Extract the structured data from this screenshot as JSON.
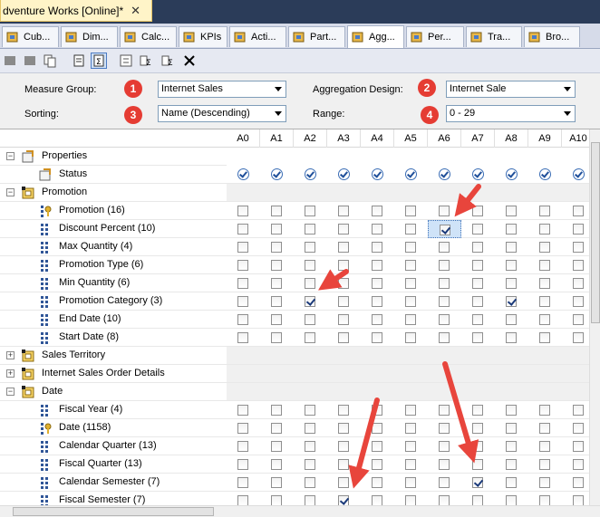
{
  "doc_tab": {
    "title": "dventure Works [Online]*",
    "close": "✕"
  },
  "designer_tabs": [
    {
      "label": "Cub...",
      "icon": "cube-icon"
    },
    {
      "label": "Dim...",
      "icon": "dimension-icon"
    },
    {
      "label": "Calc...",
      "icon": "calculations-icon"
    },
    {
      "label": "KPIs",
      "icon": "kpi-icon"
    },
    {
      "label": "Acti...",
      "icon": "actions-icon"
    },
    {
      "label": "Part...",
      "icon": "partitions-icon"
    },
    {
      "label": "Agg...",
      "icon": "aggregations-icon"
    },
    {
      "label": "Per...",
      "icon": "perspectives-icon"
    },
    {
      "label": "Tra...",
      "icon": "translations-icon"
    },
    {
      "label": "Bro...",
      "icon": "browser-icon"
    }
  ],
  "filters": {
    "measure_group_label": "Measure Group:",
    "measure_group_value": "Internet Sales",
    "sorting_label": "Sorting:",
    "sorting_value": "Name (Descending)",
    "aggregation_design_label": "Aggregation Design:",
    "aggregation_design_value": "Internet Sale",
    "range_label": "Range:",
    "range_value": "0 - 29"
  },
  "badges": [
    "1",
    "2",
    "3",
    "4"
  ],
  "columns": [
    "A0",
    "A1",
    "A2",
    "A3",
    "A4",
    "A5",
    "A6",
    "A7",
    "A8",
    "A9",
    "A10"
  ],
  "rows": [
    {
      "label": "Properties",
      "level": 0,
      "expander": "−",
      "kind": "header",
      "icon": "properties-icon"
    },
    {
      "label": "Status",
      "level": 1,
      "kind": "status",
      "icon": "status-icon"
    },
    {
      "label": "Promotion",
      "level": 0,
      "expander": "−",
      "kind": "header",
      "icon": "dimension-icon"
    },
    {
      "label": "Promotion (16)",
      "level": 1,
      "kind": "attr",
      "icon": "key-attribute-icon",
      "checked": []
    },
    {
      "label": "Discount Percent (10)",
      "level": 1,
      "kind": "attr",
      "icon": "attribute-icon",
      "checked": [
        6
      ],
      "selected": 6
    },
    {
      "label": "Max Quantity (4)",
      "level": 1,
      "kind": "attr",
      "icon": "attribute-icon",
      "checked": []
    },
    {
      "label": "Promotion Type (6)",
      "level": 1,
      "kind": "attr",
      "icon": "attribute-icon",
      "checked": []
    },
    {
      "label": "Min Quantity (6)",
      "level": 1,
      "kind": "attr",
      "icon": "attribute-icon",
      "checked": []
    },
    {
      "label": "Promotion Category (3)",
      "level": 1,
      "kind": "attr",
      "icon": "attribute-icon",
      "checked": [
        2,
        8
      ]
    },
    {
      "label": "End Date (10)",
      "level": 1,
      "kind": "attr",
      "icon": "attribute-icon",
      "checked": []
    },
    {
      "label": "Start Date (8)",
      "level": 1,
      "kind": "attr",
      "icon": "attribute-icon",
      "checked": []
    },
    {
      "label": "Sales Territory",
      "level": 0,
      "expander": "+",
      "kind": "header",
      "icon": "dimension-icon"
    },
    {
      "label": "Internet Sales Order Details",
      "level": 0,
      "expander": "+",
      "kind": "header",
      "icon": "dimension-icon"
    },
    {
      "label": "Date",
      "level": 0,
      "expander": "−",
      "kind": "header",
      "icon": "dimension-icon"
    },
    {
      "label": "Fiscal Year (4)",
      "level": 1,
      "kind": "attr",
      "icon": "attribute-icon",
      "checked": []
    },
    {
      "label": "Date (1158)",
      "level": 1,
      "kind": "attr",
      "icon": "key-attribute-icon",
      "checked": []
    },
    {
      "label": "Calendar Quarter (13)",
      "level": 1,
      "kind": "attr",
      "icon": "attribute-icon",
      "checked": []
    },
    {
      "label": "Fiscal Quarter (13)",
      "level": 1,
      "kind": "attr",
      "icon": "attribute-icon",
      "checked": []
    },
    {
      "label": "Calendar Semester (7)",
      "level": 1,
      "kind": "attr",
      "icon": "attribute-icon",
      "checked": [
        7
      ]
    },
    {
      "label": "Fiscal Semester (7)",
      "level": 1,
      "kind": "attr",
      "icon": "attribute-icon",
      "checked": [
        3
      ]
    }
  ],
  "colors": {
    "accent_red": "#e53c33",
    "tab_bar": "#2b3c59",
    "check": "#1b3a7a"
  }
}
